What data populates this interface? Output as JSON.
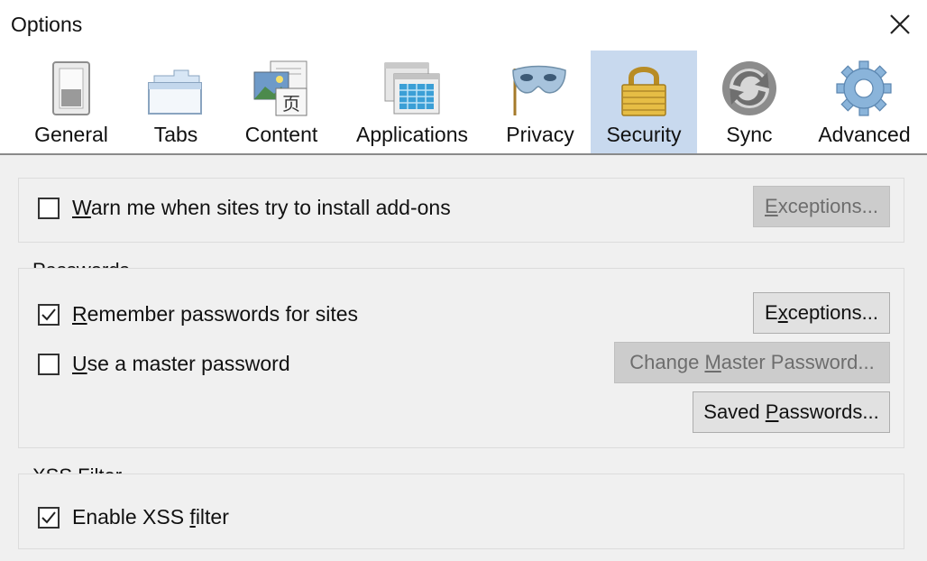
{
  "window": {
    "title": "Options"
  },
  "tabs": [
    {
      "id": "general",
      "label": "General",
      "icon": "switch-icon"
    },
    {
      "id": "tabs",
      "label": "Tabs",
      "icon": "tabs-icon"
    },
    {
      "id": "content",
      "label": "Content",
      "icon": "content-icon"
    },
    {
      "id": "applications",
      "label": "Applications",
      "icon": "applications-icon"
    },
    {
      "id": "privacy",
      "label": "Privacy",
      "icon": "mask-icon"
    },
    {
      "id": "security",
      "label": "Security",
      "icon": "padlock-icon",
      "selected": true
    },
    {
      "id": "sync",
      "label": "Sync",
      "icon": "sync-icon"
    },
    {
      "id": "advanced",
      "label": "Advanced",
      "icon": "gear-icon"
    }
  ],
  "addons": {
    "warn_checked": false,
    "warn_label": {
      "before": "",
      "key": "W",
      "after": "arn me when sites try to install add-ons"
    },
    "exceptions_button": {
      "before": "",
      "key": "E",
      "after": "xceptions...",
      "disabled": true
    }
  },
  "passwords": {
    "title": "Passwords",
    "remember_checked": true,
    "remember_label": {
      "before": "",
      "key": "R",
      "after": "emember passwords for sites"
    },
    "exceptions_button": {
      "before": "E",
      "key": "x",
      "after": "ceptions..."
    },
    "master_checked": false,
    "master_label": {
      "before": "",
      "key": "U",
      "after": "se a master password"
    },
    "change_master_button": {
      "before": "Change ",
      "key": "M",
      "after": "aster Password...",
      "disabled": true
    },
    "saved_passwords_button": {
      "before": "Saved ",
      "key": "P",
      "after": "asswords..."
    }
  },
  "xss": {
    "title": "XSS Filter",
    "enable_checked": true,
    "enable_label": {
      "before": "Enable XSS ",
      "key": "f",
      "after": "ilter"
    }
  },
  "colors": {
    "selected_tab": "#c8d9ee",
    "disabled_button": "#cccccc",
    "button": "#e1e1e1"
  }
}
